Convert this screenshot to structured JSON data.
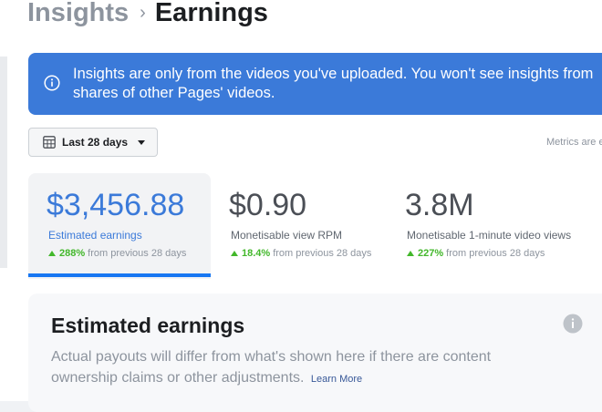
{
  "breadcrumb": {
    "parent": "Insights",
    "current": "Earnings"
  },
  "banner": {
    "text_line1": "Insights are only from the videos you've uploaded. You won't see insights from",
    "text_line2": "shares of other Pages' videos.",
    "icon": "info-icon"
  },
  "date_range": {
    "label": "Last 28 days",
    "icon": "calendar-icon"
  },
  "metrics_note": "Metrics are e",
  "metrics": [
    {
      "value": "$3,456.88",
      "name": "Estimated earnings",
      "change": "288%",
      "comparison": "from previous 28 days",
      "selected": true
    },
    {
      "value": "$0.90",
      "name": "Monetisable view RPM",
      "change": "18.4%",
      "comparison": "from previous 28 days",
      "selected": false
    },
    {
      "value": "3.8M",
      "name": "Monetisable 1-minute video views",
      "change": "227%",
      "comparison": "from previous 28 days",
      "selected": false
    }
  ],
  "card": {
    "title": "Estimated earnings",
    "description": "Actual payouts will differ from what's shown here if there are content ownership claims or other adjustments.",
    "learn_more": "Learn More"
  },
  "colors": {
    "banner": "#3b7ad9",
    "accent": "#1877f2",
    "positive": "#42b72a"
  }
}
